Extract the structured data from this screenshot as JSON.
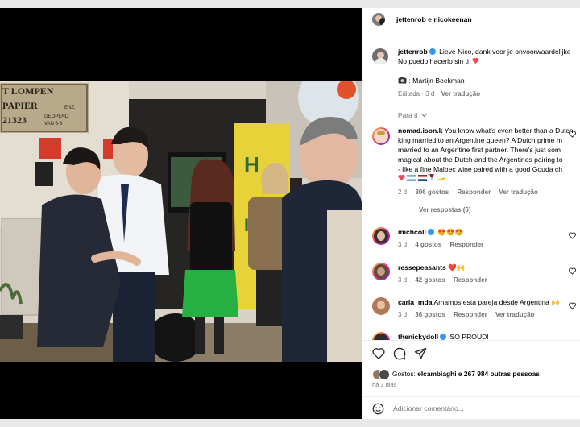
{
  "header": {
    "title_user1": "jettenrob",
    "title_sep": " e ",
    "title_user2": "nicokeenan"
  },
  "caption": {
    "username": "jettenrob",
    "text_line1": "Lieve Nico, dank voor je onvoorwaardelijke",
    "text_line2": "No puedo hacerlo sin ti",
    "credit": ": Martijn Beekman",
    "edited": "Editada · 3 d",
    "see_translation": "Ver tradução"
  },
  "for_you_label": "Para ti",
  "comments": [
    {
      "username": "nomad.ison.k",
      "lines": [
        "You know what's even better than a Dutch",
        "king married to an Argentine queen? A Dutch prime m",
        "married to an Argentine first partner. There's just som",
        "magical about the Dutch and the Argentines pairing to",
        "- like a fine Malbec wine paired with a good Gouda ch"
      ],
      "time": "2 d",
      "likes": "306 gostos",
      "reply": "Responder",
      "translate": "Ver tradução",
      "view_replies": "Ver respostas (6)"
    },
    {
      "username": "michcoll",
      "text": "😍😍😍",
      "time": "3 d",
      "likes": "4 gostos",
      "reply": "Responder"
    },
    {
      "username": "ressepeasants",
      "text": "❤️🙌",
      "time": "3 d",
      "likes": "42 gostos",
      "reply": "Responder"
    },
    {
      "username": "carla_mda",
      "text": "Amamos esta pareja desde Argentina 🙌",
      "time": "3 d",
      "likes": "36 gostos",
      "reply": "Responder",
      "translate": "Ver tradução"
    },
    {
      "username": "thenickydoll",
      "text": "SO PROUD!"
    }
  ],
  "likes_summary": {
    "prefix": "Gostos: ",
    "user": "elcambiaghi",
    "rest": " e 267 984 outras pessoas"
  },
  "post_time": "há 3 dias",
  "add_comment_placeholder": "Adicionar comentário...",
  "photo_sign": {
    "line1": "T LOMPEN",
    "line2": "PAPIER",
    "line3": "21323",
    "small1": "ENZ.",
    "small2": "GEOPEND",
    "small3": "VAN 6-8"
  },
  "colors": {
    "verified": "#3797f0",
    "heart_red": "#ed4956",
    "meta_gray": "#737373",
    "poster_yellow": "#e8d23a"
  }
}
